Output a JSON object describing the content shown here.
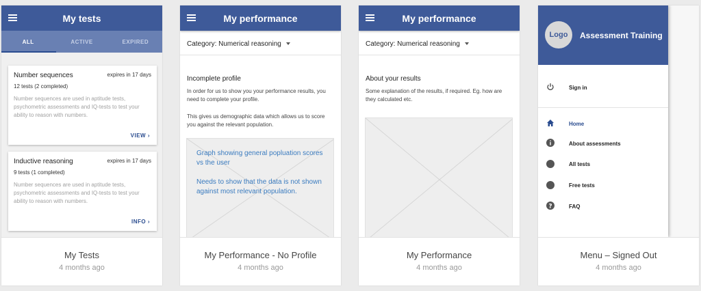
{
  "cards": [
    {
      "caption": "My Tests",
      "time": "4 months ago",
      "appbar_title": "My tests",
      "tabs": [
        "ALL",
        "ACTIVE",
        "EXPIRED"
      ],
      "tests": [
        {
          "name": "Number sequences",
          "expires": "expires in 17 days",
          "count": "12 tests (2 completed)",
          "description": "Number sequences are used in aptitude tests, psychometric assessments and IQ-tests to test your ability to reason with numbers.",
          "action": "VIEW"
        },
        {
          "name": "Inductive reasoning",
          "expires": "expires in 17 days",
          "count": "9 tests (1 completed)",
          "description": "Number sequences are used in aptitude tests, psychometric assessments and IQ-tests to test your ability to reason with numbers.",
          "action": "INFO"
        }
      ]
    },
    {
      "caption": "My Performance - No Profile",
      "time": "4 months ago",
      "appbar_title": "My performance",
      "category": "Category: Numerical reasoning",
      "section_title": "Incomplete profile",
      "text1": "In order for us to show you your performance results, you need to complete your profile.",
      "text2": "This gives us demographic data which allows us to score you against the relevant population.",
      "note1": "Graph showing general popluation scores vs the user",
      "note2": "Needs to show that the data is not shown against most relevant population."
    },
    {
      "caption": "My Performance",
      "time": "4 months ago",
      "appbar_title": "My performance",
      "category": "Category: Numerical reasoning",
      "section_title": "About your results",
      "text1": "Some explanation of the results, if required. Eg. how are they calculated etc."
    },
    {
      "caption": "Menu – Signed Out",
      "time": "4 months ago",
      "logo": "Logo",
      "app_name": "Assessment Training",
      "signin": "Sign in",
      "menu": [
        {
          "label": "Home",
          "icon": "home-icon",
          "active": true
        },
        {
          "label": "About assessments",
          "icon": "info-icon",
          "active": false
        },
        {
          "label": "All tests",
          "icon": "circle-icon",
          "active": false
        },
        {
          "label": "Free tests",
          "icon": "circle-icon",
          "active": false
        },
        {
          "label": "FAQ",
          "icon": "help-icon",
          "active": false
        }
      ]
    }
  ],
  "colors": {
    "primary": "#3e5a99",
    "tabs": "#6980b3",
    "link": "#2a4c8f",
    "note": "#3a7bbf"
  }
}
